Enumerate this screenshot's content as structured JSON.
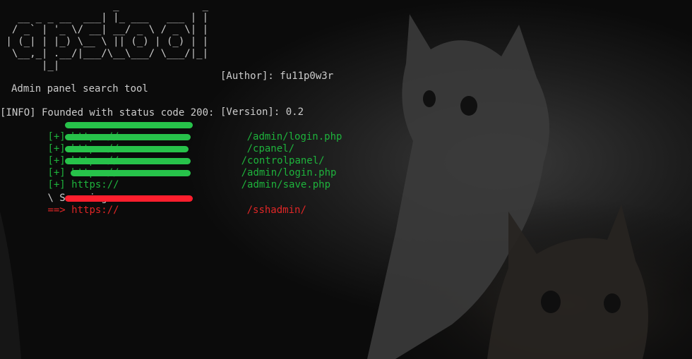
{
  "banner": {
    "ascii_art": "                   _              _ \n   __ _ _ __  ___| |_ ___   ___ | |\n  / _` | '_ \\/ __| __/ _ \\ / _ \\| |\n | (_| | |_) \\__ \\ || (_) | (_) | |\n  \\__,_| .__/|___/\\__\\___/ \\___/|_|\n       |_|                          ",
    "author": "[Author]: fu11p0w3r",
    "version": "[Version]: 0.2",
    "tagline": "Admin panel search tool"
  },
  "log": {
    "info_line": "[INFO] Founded with status code 200:",
    "results": [
      {
        "prefix": "[+] https://",
        "suffix": "/admin/login.php"
      },
      {
        "prefix": "[+] https://",
        "suffix": "/cpanel/"
      },
      {
        "prefix": "[+] https://",
        "suffix": "/controlpanel/"
      },
      {
        "prefix": "[+] https://",
        "suffix": "/admin/login.php"
      },
      {
        "prefix": "[+] https://",
        "suffix": "/admin/save.php"
      }
    ],
    "scanning_line": "\\ Scanning...",
    "current_prefix": "==> https://",
    "current_suffix": "/sshadmin/"
  },
  "colors": {
    "text": "#cccccc",
    "success": "#1eb33c",
    "current": "#e02626",
    "redaction_green": "#27c24a",
    "redaction_red": "#ff1e2d",
    "background": "#0b0b0b"
  }
}
